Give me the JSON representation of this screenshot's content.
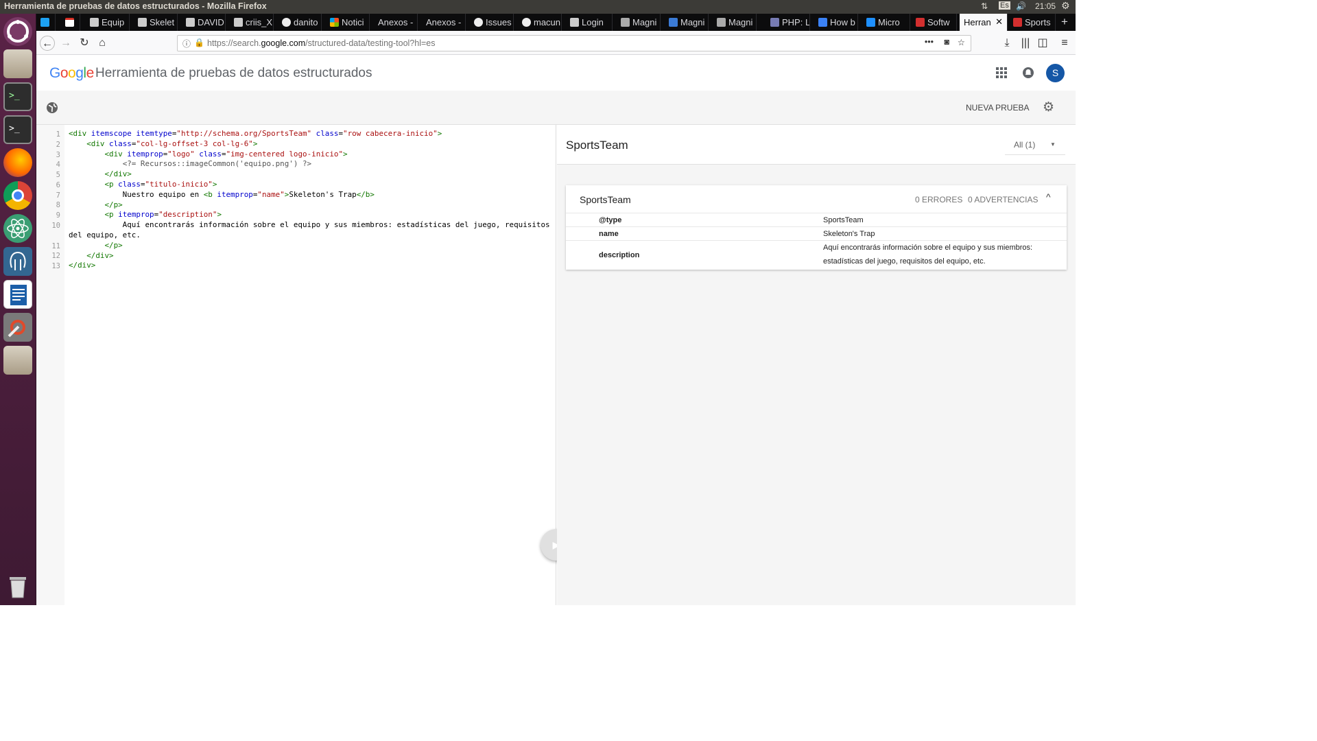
{
  "os_bar": {
    "window_title": "Herramienta de pruebas de datos estructurados - Mozilla Firefox",
    "keyboard": "Es",
    "time": "21:05"
  },
  "launcher": {
    "items": [
      "ubuntu-dash-icon",
      "files-icon",
      "terminal-icon",
      "terminal-icon",
      "firefox-icon",
      "chrome-icon",
      "atom-icon",
      "pgadmin-icon",
      "writer-icon",
      "settings-icon",
      "archive-icon",
      "trash-icon"
    ]
  },
  "tabs": [
    {
      "label": "",
      "icon": "twitter-icon"
    },
    {
      "label": "",
      "icon": "gmail-icon"
    },
    {
      "label": "Equip"
    },
    {
      "label": "Skelet"
    },
    {
      "label": "DAVID"
    },
    {
      "label": "criis_X"
    },
    {
      "label": "danito"
    },
    {
      "label": "Notici"
    },
    {
      "label": "Anexos -"
    },
    {
      "label": "Anexos -"
    },
    {
      "label": "Issues"
    },
    {
      "label": "macun"
    },
    {
      "label": "Login"
    },
    {
      "label": "Magni"
    },
    {
      "label": "Magni"
    },
    {
      "label": "Magni"
    },
    {
      "label": "PHP: L"
    },
    {
      "label": "How b"
    },
    {
      "label": "Micro"
    },
    {
      "label": "Softw"
    },
    {
      "label": "Herran",
      "active": true
    },
    {
      "label": "Sports"
    }
  ],
  "url": {
    "prefix": "https://search.",
    "domain": "google.com",
    "path": "/structured-data/testing-tool?hl=es"
  },
  "header": {
    "logo": "Google",
    "title": "Herramienta de pruebas de datos estructurados",
    "avatar_letter": "S"
  },
  "toolbar": {
    "new_test": "NUEVA PRUEBA"
  },
  "code": {
    "line_numbers": [
      "1",
      "2",
      "3",
      "4",
      "5",
      "6",
      "7",
      "8",
      "9",
      "10",
      "",
      "11",
      "12",
      "13"
    ]
  },
  "results": {
    "heading": "SportsTeam",
    "filter": "All (1)",
    "card_title": "SportsTeam",
    "errors": "0 ERRORES",
    "warnings": "0 ADVERTENCIAS",
    "rows": [
      {
        "prop": "@type",
        "value": "SportsTeam"
      },
      {
        "prop": "name",
        "value": "Skeleton's Trap"
      },
      {
        "prop": "description",
        "value_line1": "Aquí encontrarás información sobre el equipo y sus miembros:",
        "value_line2": "estadísticas del juego, requisitos del equipo, etc."
      }
    ]
  }
}
